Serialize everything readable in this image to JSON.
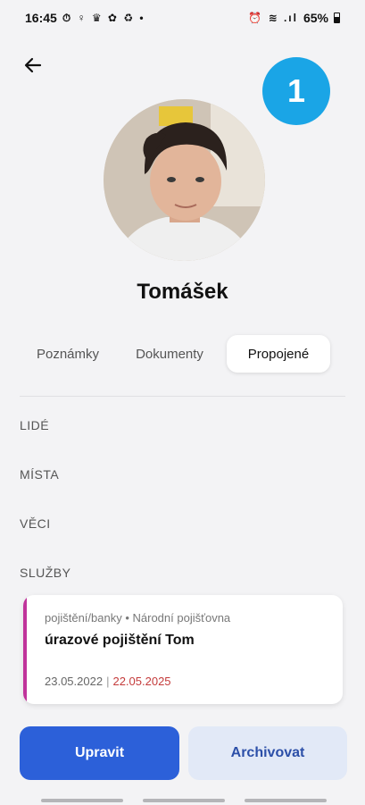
{
  "status_bar": {
    "time": "16:45",
    "left_glyphs": "⏱ ♀ ♛ ✿ ♻ •",
    "right_glyphs": "⏰ ≋ .ıl",
    "battery": "65%"
  },
  "step_badge": "1",
  "profile": {
    "name": "Tomášek"
  },
  "tabs": [
    {
      "label": "Poznámky",
      "active": false
    },
    {
      "label": "Dokumenty",
      "active": false
    },
    {
      "label": "Propojené",
      "active": true
    }
  ],
  "sections": {
    "people": "LIDÉ",
    "places": "MÍSTA",
    "things": "VĚCI",
    "services": "SLUŽBY"
  },
  "service_card": {
    "meta": "pojištění/banky • Národní pojišťovna",
    "title": "úrazové pojištění Tom",
    "date_start": "23.05.2022",
    "separator": "|",
    "date_end": "22.05.2025",
    "accent_color": "#c0339b"
  },
  "actions": {
    "edit_label": "Upravit",
    "archive_label": "Archivovat"
  },
  "colors": {
    "primary": "#2c60d9",
    "badge": "#1aa5e6",
    "date_end": "#c43b3b"
  }
}
